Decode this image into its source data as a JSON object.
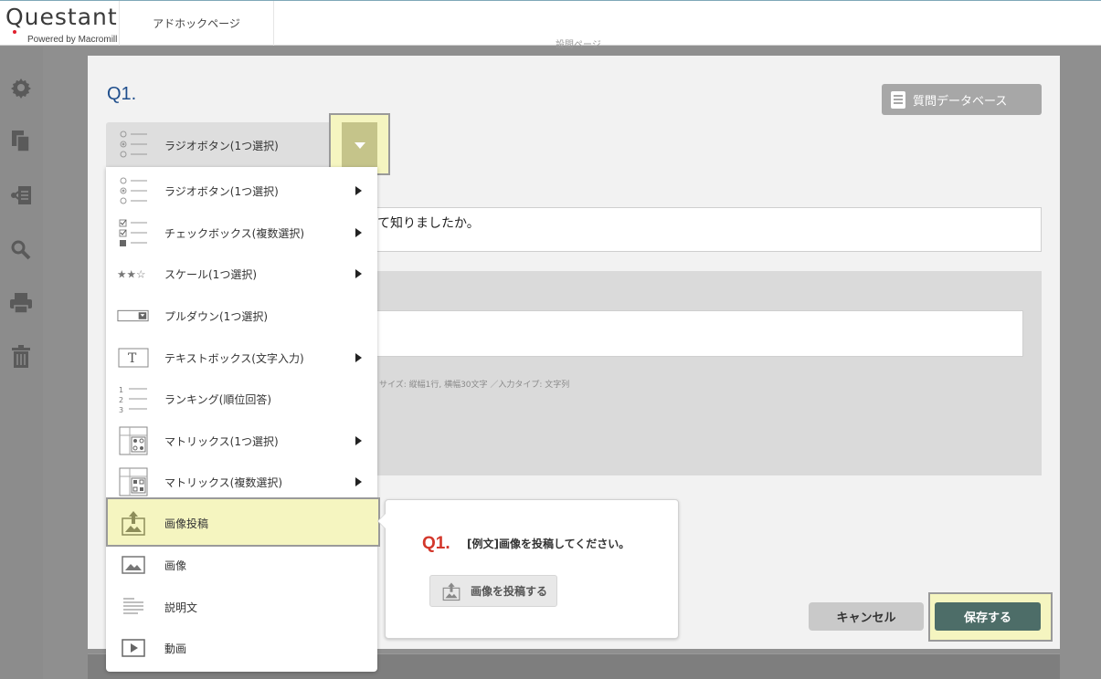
{
  "app": {
    "logo_text": "Questant",
    "logo_sub": "Powered by Macromill",
    "page_tab": "アドホックページ",
    "faint_title": "設問ページ"
  },
  "sidebar": {
    "icons": [
      "gear-icon",
      "copy-icon",
      "share-icon",
      "search-icon",
      "print-icon",
      "trash-icon"
    ]
  },
  "editor": {
    "question_number": "Q1.",
    "question_db_button": "質問データベース",
    "question_text_partial": "て知りましたか。",
    "answer_hint": "サイズ: 縦幅1行, 横幅30文字 ／入力タイプ: 文字列",
    "cancel_button": "キャンセル",
    "save_button": "保存する"
  },
  "type_select": {
    "selected": "ラジオボタン(1つ選択)"
  },
  "menu": {
    "items": [
      {
        "label": "ラジオボタン(1つ選択)",
        "icon": "radio-list-icon",
        "submenu": true
      },
      {
        "label": "チェックボックス(複数選択)",
        "icon": "checkbox-list-icon",
        "submenu": true
      },
      {
        "label": "スケール(1つ選択)",
        "icon": "stars-scale-icon",
        "submenu": true
      },
      {
        "label": "プルダウン(1つ選択)",
        "icon": "pulldown-icon",
        "submenu": false
      },
      {
        "label": "テキストボックス(文字入力)",
        "icon": "textbox-icon",
        "submenu": true
      },
      {
        "label": "ランキング(順位回答)",
        "icon": "ranking-icon",
        "submenu": false
      },
      {
        "label": "マトリックス(1つ選択)",
        "icon": "matrix-radio-icon",
        "submenu": true
      },
      {
        "label": "マトリックス(複数選択)",
        "icon": "matrix-check-icon",
        "submenu": true
      },
      {
        "label": "画像投稿",
        "icon": "image-upload-icon",
        "submenu": false,
        "highlighted": true
      },
      {
        "label": "画像",
        "icon": "image-icon",
        "submenu": false
      },
      {
        "label": "説明文",
        "icon": "description-text-icon",
        "submenu": false
      },
      {
        "label": "動画",
        "icon": "video-icon",
        "submenu": false
      }
    ]
  },
  "tooltip": {
    "q_number": "Q1.",
    "text": "[例文]画像を投稿してください。",
    "button": "画像を投稿する"
  },
  "colors": {
    "highlight": "#f5f5c0",
    "save_button": "#4d6d68",
    "q_label": "#1f4e8c",
    "tooltip_q": "#d3372b"
  }
}
